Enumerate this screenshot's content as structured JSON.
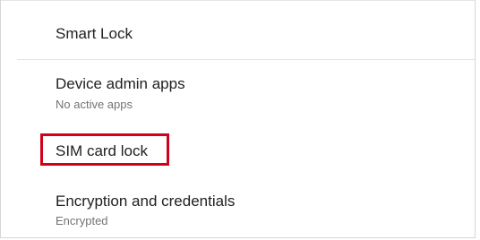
{
  "settings_list": {
    "items": [
      {
        "title": "Smart Lock"
      },
      {
        "title": "Device admin apps",
        "subtitle": "No active apps"
      },
      {
        "title": "SIM card lock",
        "highlighted": true
      },
      {
        "title": "Encryption and credentials",
        "subtitle": "Encrypted"
      }
    ]
  },
  "colors": {
    "highlight_border": "#d0021b",
    "title_text": "#212121",
    "subtitle_text": "#737373"
  }
}
